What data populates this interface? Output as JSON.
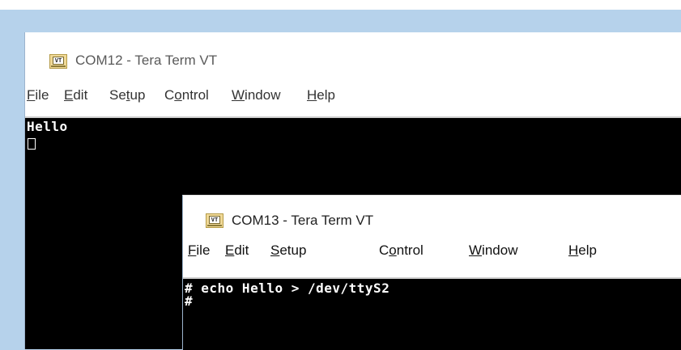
{
  "window_back": {
    "title": "COM12 - Tera Term VT",
    "icon": "tera-term-vt-icon",
    "icon_text": "VT",
    "menu": [
      {
        "key": "F",
        "rest": "ile"
      },
      {
        "key": "E",
        "rest": "dit"
      },
      {
        "pre": "Se",
        "key": "t",
        "rest": "up"
      },
      {
        "pre": "C",
        "key": "o",
        "rest": "ntrol"
      },
      {
        "key": "W",
        "rest": "indow"
      },
      {
        "key": "H",
        "rest": "elp"
      }
    ],
    "terminal_lines": [
      "Hello"
    ]
  },
  "window_front": {
    "title": "COM13 - Tera Term VT",
    "icon": "tera-term-vt-icon",
    "icon_text": "VT",
    "menu": [
      {
        "key": "F",
        "rest": "ile"
      },
      {
        "key": "E",
        "rest": "dit"
      },
      {
        "key": "S",
        "rest": "etup"
      },
      {
        "pre": "C",
        "key": "o",
        "rest": "ntrol"
      },
      {
        "key": "W",
        "rest": "indow"
      },
      {
        "key": "H",
        "rest": "elp"
      }
    ],
    "terminal_lines": [
      "# echo Hello > /dev/ttyS2",
      "#"
    ]
  },
  "colors": {
    "terminal_bg": "#000000",
    "terminal_fg": "#ffffff",
    "desktop": "#b6d2eb"
  }
}
